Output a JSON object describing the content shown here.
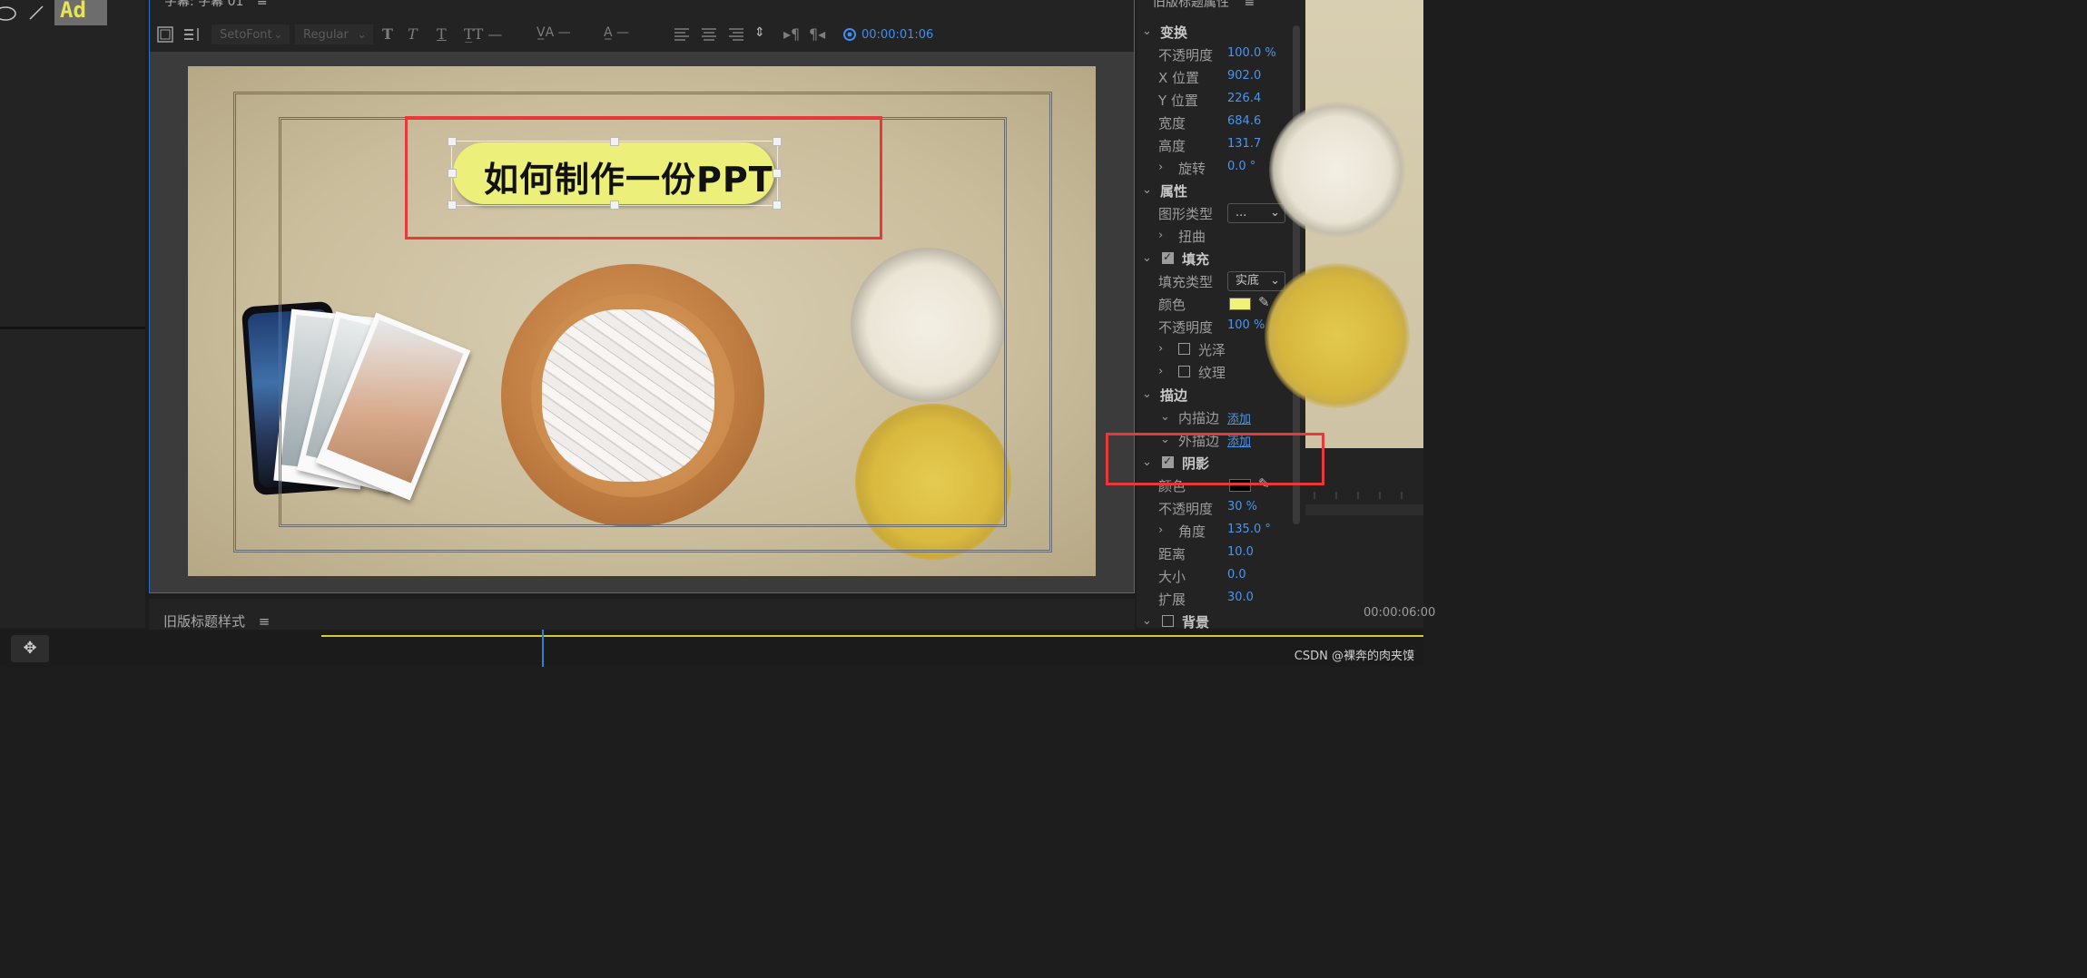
{
  "left_panel": {
    "thumb_text": "Ad",
    "tools": [
      "ellipse-tool",
      "line-tool"
    ]
  },
  "editor": {
    "title": "字幕: 字幕 01",
    "menu_glyph": "≡",
    "toolbar": {
      "font": "SetoFont",
      "style": "Regular",
      "timecode": "00:00:01:06"
    },
    "title_text": "如何制作一份PPT"
  },
  "properties": {
    "panel_title": "旧版标题属性",
    "menu_glyph": "≡",
    "rows": [
      {
        "type": "section",
        "label": "变换"
      },
      {
        "type": "value",
        "label": "不透明度",
        "value": "100.0 %"
      },
      {
        "type": "value",
        "label": "X 位置",
        "value": "902.0"
      },
      {
        "type": "value",
        "label": "Y 位置",
        "value": "226.4"
      },
      {
        "type": "value",
        "label": "宽度",
        "value": "684.6"
      },
      {
        "type": "value",
        "label": "高度",
        "value": "131.7"
      },
      {
        "type": "value",
        "label": "旋转",
        "value": "0.0 °"
      },
      {
        "type": "section",
        "label": "属性"
      },
      {
        "type": "dropdown",
        "label": "图形类型",
        "value": "..."
      },
      {
        "type": "sub",
        "label": "扭曲"
      },
      {
        "type": "check-section",
        "label": "填充",
        "checked": true
      },
      {
        "type": "dropdown",
        "label": "填充类型",
        "value": "实底"
      },
      {
        "type": "color",
        "label": "颜色",
        "color": "#f0f27a"
      },
      {
        "type": "value",
        "label": "不透明度",
        "value": "100 %"
      },
      {
        "type": "check-sub",
        "label": "光泽",
        "checked": false
      },
      {
        "type": "check-sub",
        "label": "纹理",
        "checked": false
      },
      {
        "type": "section",
        "label": "描边"
      },
      {
        "type": "link",
        "label": "内描边",
        "value": "添加"
      },
      {
        "type": "link",
        "label": "外描边",
        "value": "添加"
      },
      {
        "type": "check-section",
        "label": "阴影",
        "checked": true
      },
      {
        "type": "color",
        "label": "颜色",
        "color": "#000000"
      },
      {
        "type": "value",
        "label": "不透明度",
        "value": "30 %"
      },
      {
        "type": "value",
        "label": "角度",
        "value": "135.0 °"
      },
      {
        "type": "value",
        "label": "距离",
        "value": "10.0"
      },
      {
        "type": "value",
        "label": "大小",
        "value": "0.0"
      },
      {
        "type": "value",
        "label": "扩展",
        "value": "30.0"
      },
      {
        "type": "check-section",
        "label": "背景",
        "checked": false
      }
    ]
  },
  "program_monitor": {
    "timecode": "00:00:06:00"
  },
  "styles_panel": {
    "title": "旧版标题样式",
    "menu_glyph": "≡"
  },
  "watermark": "CSDN @裸奔的肉夹馍",
  "colors": {
    "accent": "#2d6ec9",
    "value_blue": "#4d95ea",
    "highlight_red": "#e8393a",
    "title_pill": "#ecf07a"
  }
}
